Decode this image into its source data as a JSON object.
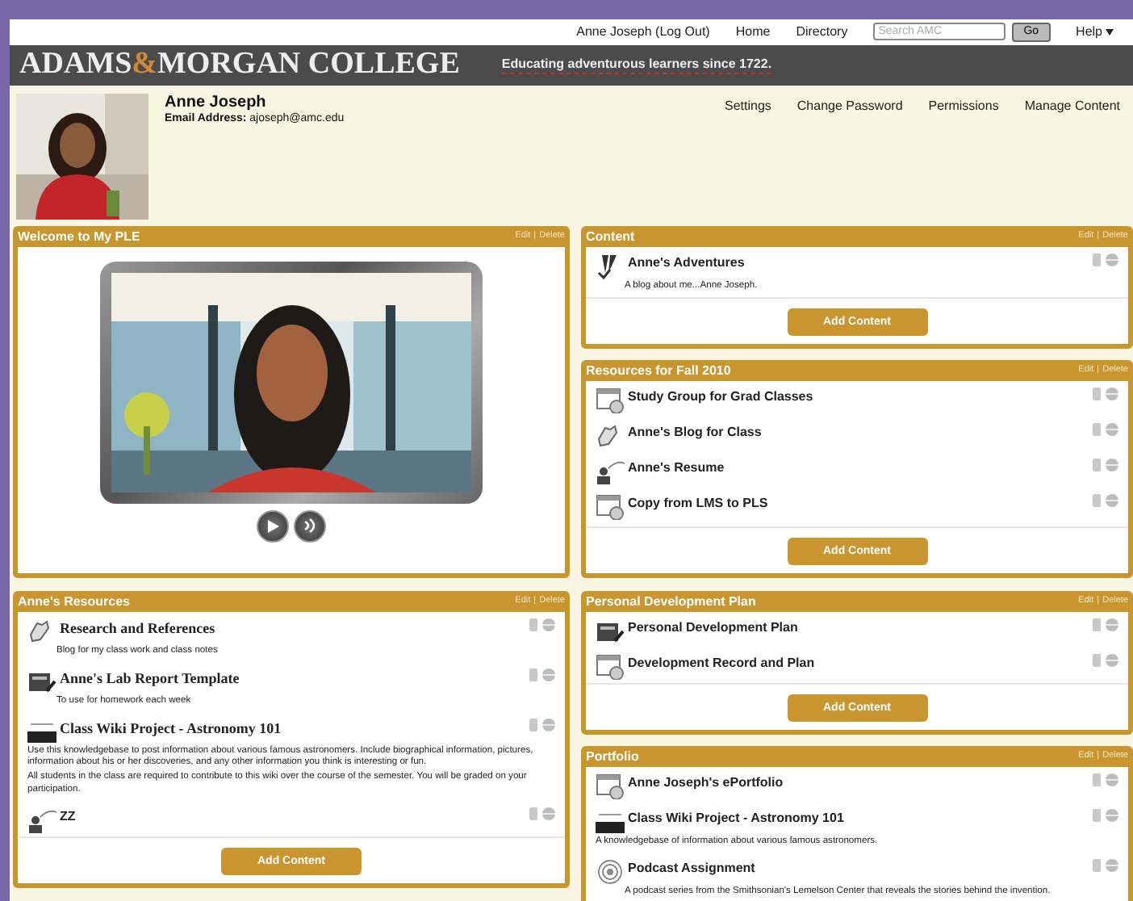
{
  "top_nav": {
    "links": [
      {
        "label": "Anne Joseph (Log Out)"
      },
      {
        "label": "Home"
      },
      {
        "label": "Directory"
      }
    ],
    "search": {
      "placeholder": "Search AMC"
    },
    "go_button": "Go",
    "help": "Help"
  },
  "header": {
    "logo": {
      "before": "ADAMS",
      "amp": "&",
      "after": "MORGAN COLLEGE"
    },
    "tagline": "Educating adventurous learners since 1722."
  },
  "profile": {
    "name": "Anne Joseph",
    "email_label": "Email Address:",
    "email": "ajoseph@amc.edu",
    "links": [
      "Settings",
      "Change Password",
      "Permissions",
      "Manage Content"
    ]
  },
  "columns": [
    [
      {
        "kind": "video",
        "title": "Welcome to My PLE",
        "actions": [
          "Edit",
          "Delete"
        ],
        "action_separator": "|"
      },
      {
        "kind": "list",
        "title": "Anne's Resources",
        "actions": [
          "Edit",
          "Delete"
        ],
        "action_separator": "|",
        "add_button": "Add Content",
        "items": [
          {
            "kind": "blog",
            "title": "Research and References",
            "serif": true,
            "description": [
              "Blog for my class work and class notes"
            ]
          },
          {
            "kind": "notes",
            "title": "Anne's Lab Report Template",
            "serif": true,
            "description": [
              "To use for homework each week"
            ]
          },
          {
            "kind": "wiki",
            "title": "Class Wiki Project - Astronomy 101",
            "serif": true,
            "description": [
              "Use this knowledgebase to post information about various famous astronomers. Include biographical information, pictures, information about his or her discoveries, and any other information you think is interesting or fun.",
              "All students in the class are required to contribute to this wiki over the course of the semester.  You will be graded on your participation."
            ]
          },
          {
            "kind": "resume",
            "title": "ZZ",
            "serif": false
          }
        ]
      }
    ],
    [
      {
        "kind": "list",
        "title": "Content",
        "actions": [
          "Edit",
          "Delete"
        ],
        "action_separator": "|",
        "add_button": "Add Content",
        "items": [
          {
            "kind": "quill",
            "title": "Anne's Adventures",
            "serif": false,
            "description": [
              "A blog about me...Anne Joseph."
            ]
          }
        ]
      },
      {
        "kind": "list",
        "title": "Resources for Fall 2010",
        "actions": [
          "Edit",
          "Delete"
        ],
        "action_separator": "|",
        "add_button": "Add Content",
        "items": [
          {
            "kind": "window",
            "title": "Study Group for Grad Classes",
            "serif": false
          },
          {
            "kind": "blog",
            "title": "Anne's Blog for Class",
            "serif": false
          },
          {
            "kind": "resume",
            "title": "Anne's Resume",
            "serif": false
          },
          {
            "kind": "window",
            "title": "Copy from LMS to PLS",
            "serif": false
          }
        ]
      },
      {
        "kind": "list",
        "title": "Personal Development Plan",
        "actions": [
          "Edit",
          "Delete"
        ],
        "action_separator": "|",
        "add_button": "Add Content",
        "items": [
          {
            "kind": "notes",
            "title": "Personal Development Plan",
            "serif": false
          },
          {
            "kind": "window",
            "title": "Development Record and Plan",
            "serif": false
          }
        ]
      },
      {
        "kind": "list",
        "title": "Portfolio",
        "actions": [
          "Edit",
          "Delete"
        ],
        "action_separator": "|",
        "items": [
          {
            "kind": "window",
            "title": "Anne Joseph's ePortfolio",
            "serif": false
          },
          {
            "kind": "wiki",
            "title": "Class Wiki Project - Astronomy 101",
            "serif": false,
            "description": [
              "A knowledgebase of information about various famous astronomers."
            ]
          },
          {
            "kind": "podcast",
            "title": "Podcast Assignment",
            "serif": false,
            "description": [
              "A podcast series from the Smithsonian's Lemelson Center that reveals the stories behind the invention."
            ]
          }
        ]
      }
    ]
  ]
}
